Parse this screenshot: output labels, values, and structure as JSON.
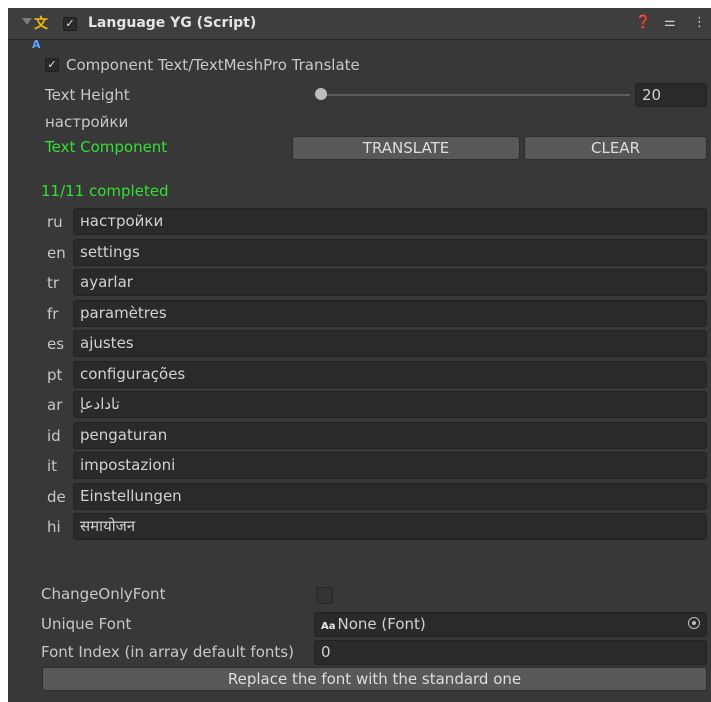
{
  "header": {
    "title": "Language YG (Script)",
    "enabled_check": "✓",
    "help_icon": "help-icon",
    "settings_icon": "sliders-icon",
    "menu_icon": "kebab-menu-icon"
  },
  "component_translate": {
    "check": "✓",
    "label": "Component Text/TextMeshPro Translate"
  },
  "text_height": {
    "label": "Text Height",
    "value": "20",
    "slider_fraction": 0.0
  },
  "source_text": "настройки",
  "text_component": {
    "label": "Text Component",
    "translate_button": "TRANSLATE",
    "clear_button": "CLEAR"
  },
  "status": "11/11 completed",
  "languages": [
    {
      "code": "ru",
      "text": "настройки"
    },
    {
      "code": "en",
      "text": "settings"
    },
    {
      "code": "tr",
      "text": "ayarlar"
    },
    {
      "code": "fr",
      "text": "paramètres"
    },
    {
      "code": "es",
      "text": "ajustes"
    },
    {
      "code": "pt",
      "text": "configurações"
    },
    {
      "code": "ar",
      "text": "تادادعإ"
    },
    {
      "code": "id",
      "text": "pengaturan"
    },
    {
      "code": "it",
      "text": "impostazioni"
    },
    {
      "code": "de",
      "text": "Einstellungen"
    },
    {
      "code": "hi",
      "text": "समायोजन"
    }
  ],
  "change_only_font": {
    "label": "ChangeOnlyFont",
    "checked": false
  },
  "unique_font": {
    "label": "Unique Font",
    "icon_text": "Aa",
    "value": "None (Font)"
  },
  "font_index": {
    "label": "Font Index (in array default fonts)",
    "value": "0"
  },
  "replace_button": "Replace the font with the standard one",
  "colors": {
    "accent_green": "#32e032",
    "background": "#383838",
    "field": "#2a2a2a"
  }
}
